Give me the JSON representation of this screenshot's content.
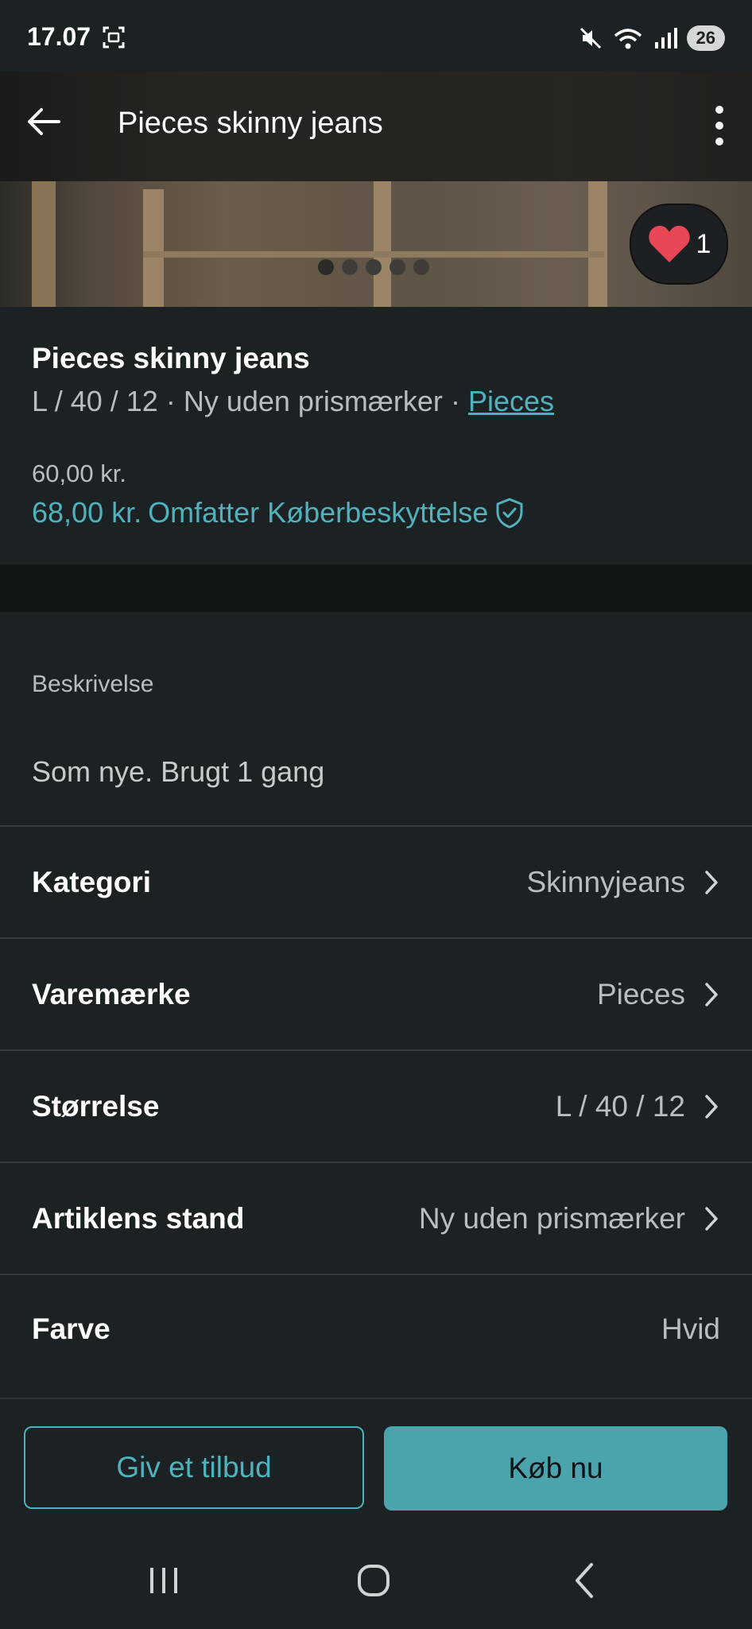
{
  "status_bar": {
    "time": "17.07",
    "battery": "26",
    "icons": [
      "screenshot-icon",
      "mute-icon",
      "wifi-icon",
      "signal-icon"
    ]
  },
  "header": {
    "title": "Pieces skinny jeans",
    "back_icon": "arrow-left-icon",
    "more_icon": "more-vertical-icon"
  },
  "photo": {
    "like_count": "1",
    "dot_count": 5,
    "active_dot": 0
  },
  "item": {
    "title": "Pieces skinny jeans",
    "size": "L / 40 / 12",
    "condition": "Ny uden prismærker",
    "separator": "·",
    "brand": "Pieces",
    "price": "60,00 kr.",
    "total_price": "68,00 kr.",
    "protection_label": "Omfatter Køberbeskyttelse"
  },
  "description": {
    "label": "Beskrivelse",
    "text": "Som nye. Brugt 1 gang"
  },
  "details": [
    {
      "label": "Kategori",
      "value": "Skinnyjeans"
    },
    {
      "label": "Varemærke",
      "value": "Pieces"
    },
    {
      "label": "Størrelse",
      "value": "L / 40 / 12"
    },
    {
      "label": "Artiklens stand",
      "value": "Ny uden prismærker"
    },
    {
      "label": "Farve",
      "value": "Hvid"
    }
  ],
  "actions": {
    "offer_label": "Giv et tilbud",
    "buy_label": "Køb nu"
  },
  "colors": {
    "accent": "#4fb2bd",
    "background": "#1c2123",
    "like_heart": "#e84855"
  }
}
